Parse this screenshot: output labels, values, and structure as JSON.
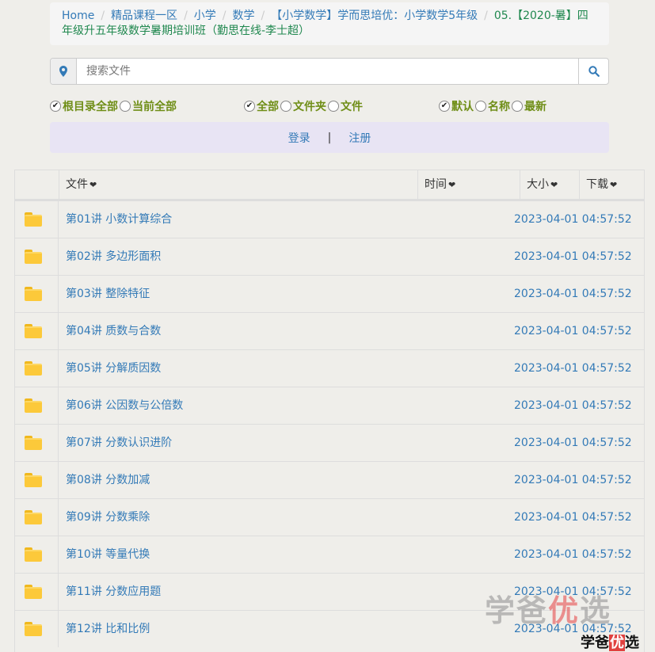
{
  "breadcrumb": {
    "items": [
      "Home",
      "精品课程一区",
      "小学",
      "数学",
      "【小学数学】学而思培优：小学数学5年级"
    ],
    "active": "05.【2020-暑】四年级升五年级数学暑期培训班（勤思在线-李士超）"
  },
  "search": {
    "placeholder": "搜索文件",
    "location_icon": "map-marker-icon",
    "search_icon": "search-icon"
  },
  "filters": {
    "scope": [
      {
        "label": "根目录全部",
        "checked": true
      },
      {
        "label": "当前全部",
        "checked": false
      }
    ],
    "type": [
      {
        "label": "全部",
        "checked": true
      },
      {
        "label": "文件夹",
        "checked": false
      },
      {
        "label": "文件",
        "checked": false
      }
    ],
    "sort": [
      {
        "label": "默认",
        "checked": true
      },
      {
        "label": "名称",
        "checked": false
      },
      {
        "label": "最新",
        "checked": false
      }
    ]
  },
  "auth": {
    "login": "登录",
    "separator": "|",
    "register": "注册"
  },
  "table": {
    "headers": {
      "file": "文件",
      "time": "时间",
      "size": "大小",
      "download": "下载",
      "caret": "❤"
    },
    "rows": [
      {
        "name": "第01讲 小数计算综合",
        "time": "2023-04-01 04:57:52"
      },
      {
        "name": "第02讲 多边形面积",
        "time": "2023-04-01 04:57:52"
      },
      {
        "name": "第03讲 整除特征",
        "time": "2023-04-01 04:57:52"
      },
      {
        "name": "第04讲 质数与合数",
        "time": "2023-04-01 04:57:52"
      },
      {
        "name": "第05讲 分解质因数",
        "time": "2023-04-01 04:57:52"
      },
      {
        "name": "第06讲 公因数与公倍数",
        "time": "2023-04-01 04:57:52"
      },
      {
        "name": "第07讲 分数认识进阶",
        "time": "2023-04-01 04:57:52"
      },
      {
        "name": "第08讲 分数加减",
        "time": "2023-04-01 04:57:52"
      },
      {
        "name": "第09讲 分数乘除",
        "time": "2023-04-01 04:57:52"
      },
      {
        "name": "第10讲 等量代换",
        "time": "2023-04-01 04:57:52"
      },
      {
        "name": "第11讲 分数应用题",
        "time": "2023-04-01 04:57:52"
      },
      {
        "name": "第12讲 比和比例",
        "time": "2023-04-01 04:57:52"
      }
    ],
    "folder_icon": "folder-icon"
  },
  "watermark": {
    "big_a": "学爸",
    "big_b": "优",
    "big_c": "选",
    "small_a": "学爸",
    "small_b": "优",
    "small_c": "选"
  },
  "colors": {
    "link": "#337ab7",
    "filter_label": "#6f8e17",
    "breadcrumb_active": "#20884f",
    "login_bar": "#e8e4f4"
  }
}
